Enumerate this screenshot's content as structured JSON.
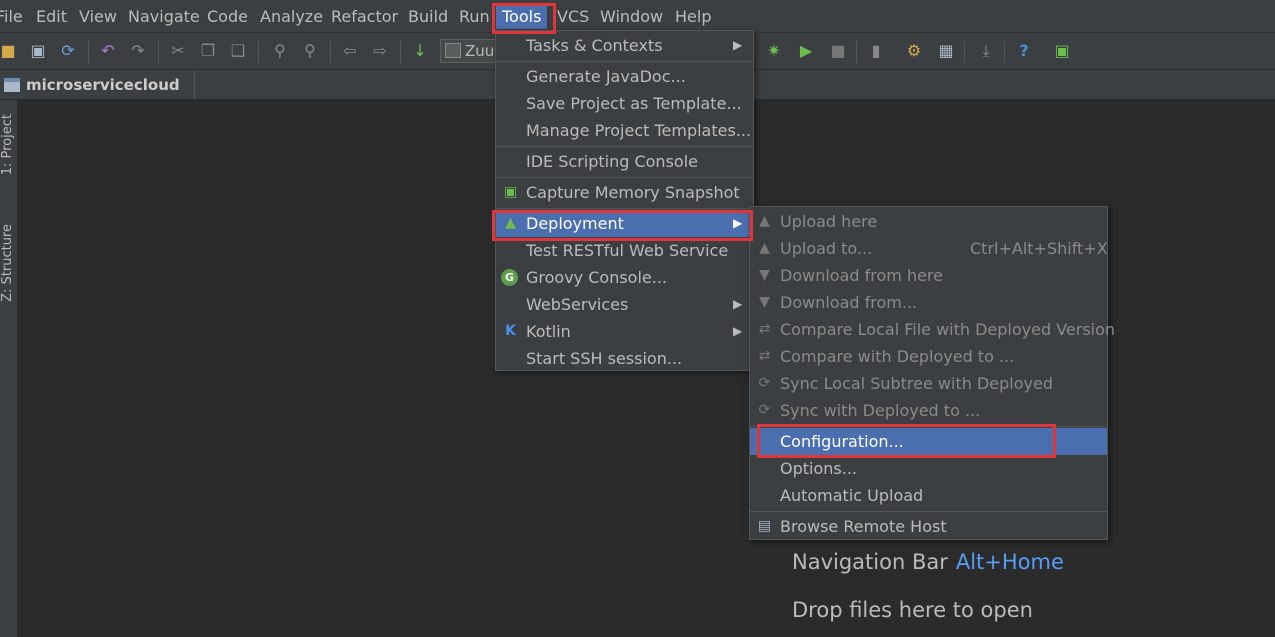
{
  "menubar": {
    "items": [
      "File",
      "Edit",
      "View",
      "Navigate",
      "Code",
      "Analyze",
      "Refactor",
      "Build",
      "Run",
      "Tools",
      "VCS",
      "Window",
      "Help"
    ],
    "active": "Tools"
  },
  "toolbar": {
    "run_config": "Zuul"
  },
  "breadcrumb": {
    "project": "microservicecloud"
  },
  "side_tabs": {
    "project": "1: Project",
    "structure": "Z: Structure"
  },
  "editor": {
    "nav_bar_label": "Navigation Bar",
    "nav_bar_shortcut": "Alt+Home",
    "drop_files": "Drop files here to open"
  },
  "tools_menu": {
    "items": [
      "Tasks & Contexts",
      "Generate JavaDoc...",
      "Save Project as Template...",
      "Manage Project Templates...",
      "IDE Scripting Console",
      "Capture Memory Snapshot",
      "Deployment",
      "Test RESTful Web Service",
      "Groovy Console...",
      "WebServices",
      "Kotlin",
      "Start SSH session..."
    ],
    "selected": "Deployment"
  },
  "deployment_menu": {
    "items": [
      "Upload here",
      "Upload to...",
      "Download from here",
      "Download from...",
      "Compare Local File with Deployed Version",
      "Compare with Deployed to ...",
      "Sync Local Subtree with Deployed",
      "Sync with Deployed to ...",
      "Configuration...",
      "Options...",
      "Automatic Upload",
      "Browse Remote Host"
    ],
    "upload_to_shortcut": "Ctrl+Alt+Shift+X",
    "selected": "Configuration..."
  },
  "colors": {
    "selection": "#4b6eaf",
    "highlight_box": "#e0363a",
    "shortcut_link": "#589df6"
  }
}
